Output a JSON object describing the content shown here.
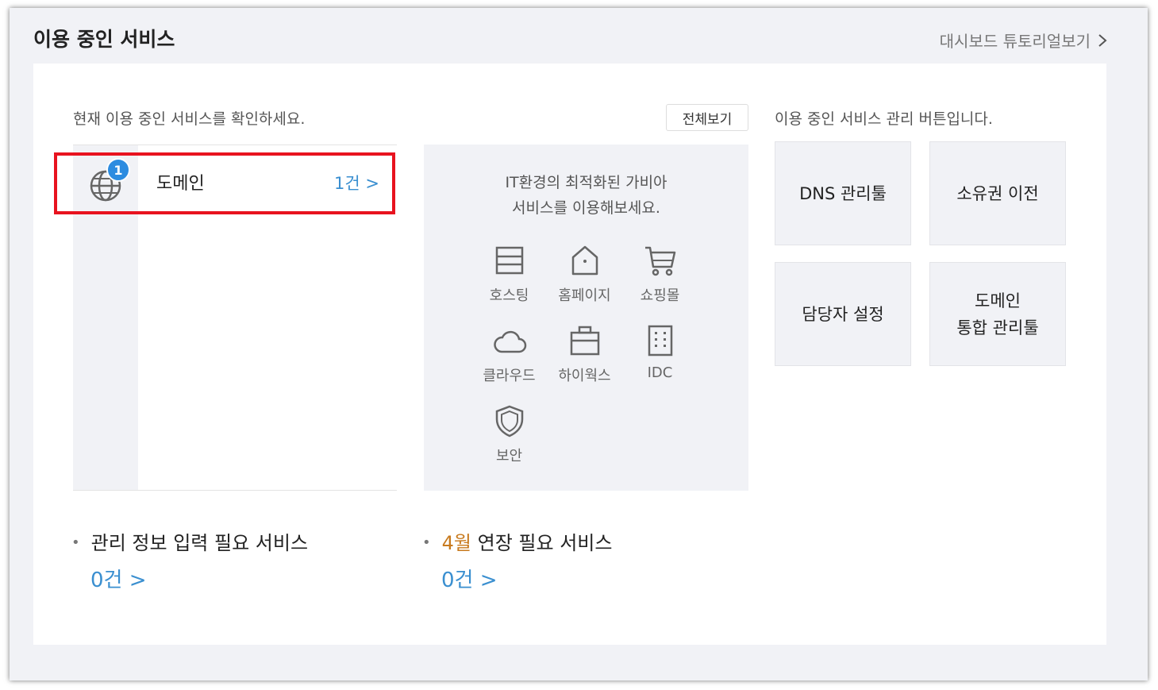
{
  "header": {
    "title": "이용 중인 서비스",
    "tutorial_link": "대시보드 튜토리얼보기"
  },
  "current": {
    "description": "현재 이용 중인 서비스를 확인하세요.",
    "view_all": "전체보기",
    "services": [
      {
        "name": "도메인",
        "count": "1건 >",
        "badge": "1",
        "icon": "globe-icon"
      }
    ]
  },
  "promo": {
    "line1": "IT환경의 최적화된 가비아",
    "line2": "서비스를 이용해보세요.",
    "items": [
      {
        "label": "호스팅",
        "icon": "server-icon"
      },
      {
        "label": "홈페이지",
        "icon": "house-icon"
      },
      {
        "label": "쇼핑몰",
        "icon": "cart-icon"
      },
      {
        "label": "클라우드",
        "icon": "cloud-icon"
      },
      {
        "label": "하이웍스",
        "icon": "briefcase-icon"
      },
      {
        "label": "IDC",
        "icon": "building-icon"
      },
      {
        "label": "보안",
        "icon": "shield-icon"
      }
    ]
  },
  "manage": {
    "description": "이용 중인 서비스 관리 버튼입니다.",
    "buttons": [
      "DNS 관리툴",
      "소유권 이전",
      "담당자 설정",
      "도메인\n통합 관리툴"
    ]
  },
  "info_required": {
    "label": "관리 정보 입력 필요 서비스",
    "count": "0건 >"
  },
  "renewal": {
    "month": "4월",
    "label": " 연장 필요 서비스",
    "count": "0건 >"
  },
  "colors": {
    "link_blue": "#3a8fd0",
    "badge_blue": "#2d8ce0",
    "month_orange": "#c87a1e",
    "highlight_red": "#e8131f",
    "panel_gray": "#f1f2f6"
  }
}
